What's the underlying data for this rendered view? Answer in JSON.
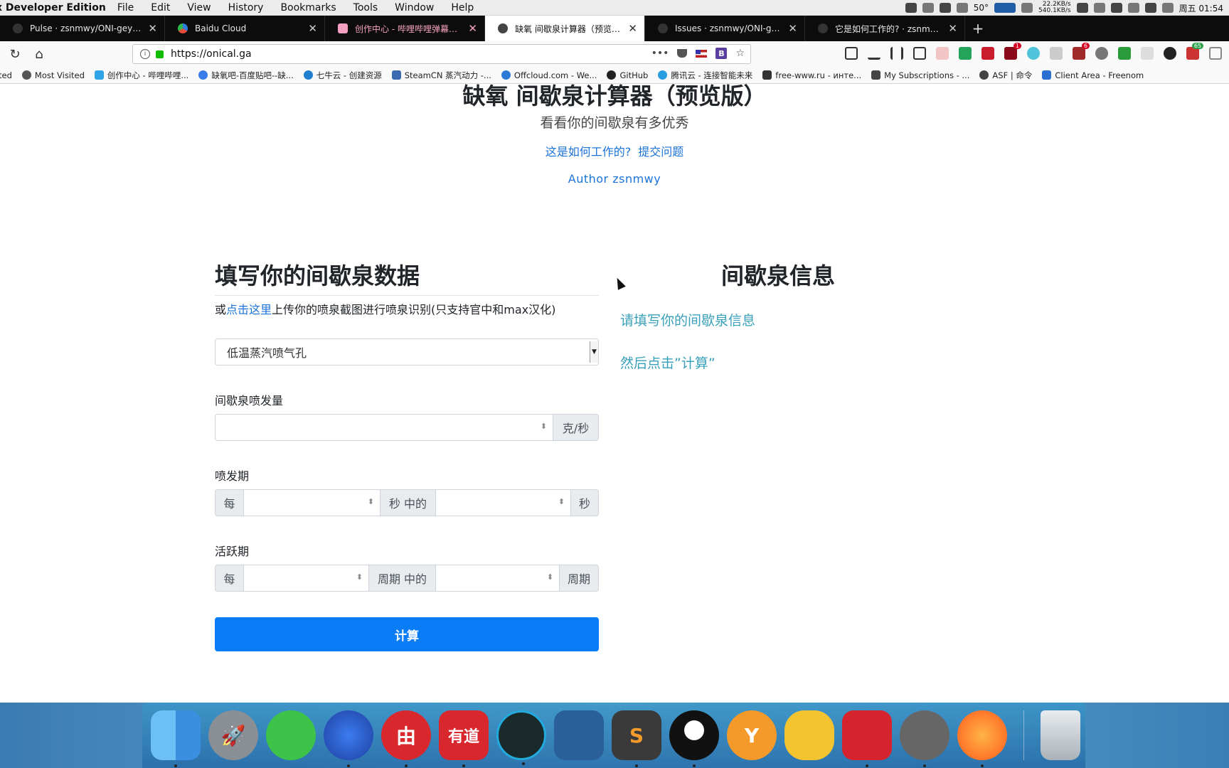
{
  "menubar": {
    "app": "x Developer Edition",
    "items": [
      "File",
      "Edit",
      "View",
      "History",
      "Bookmarks",
      "Tools",
      "Window",
      "Help"
    ],
    "temperature": "50°",
    "net_up": "22.2KB/s",
    "net_down": "540.1KB/s",
    "clock": "周五 01:54"
  },
  "tabs": [
    {
      "title": "Pulse · zsnmwy/ONI-geyser-cal",
      "favicon_color": "#333333"
    },
    {
      "title": "Baidu Cloud",
      "favicon_color": "#2f7de1"
    },
    {
      "title": "创作中心 - 哔哩哔哩弹幕视频网 -",
      "favicon_color": "#f5a0c0"
    },
    {
      "title": "缺氧 间歇泉计算器（预览版）",
      "favicon_color": "#444444"
    },
    {
      "title": "Issues · zsnmwy/ONI-geyser-ca",
      "favicon_color": "#333333"
    },
    {
      "title": "它是如何工作的? · zsnmwy/ONI",
      "favicon_color": "#333333"
    }
  ],
  "address": {
    "url": "https://onical.ga"
  },
  "bookmarks": [
    {
      "label": "ted",
      "color": "transparent"
    },
    {
      "label": "Most Visited",
      "color": "#555555"
    },
    {
      "label": "创作中心 - 哔哩哔哩...",
      "color": "#2fa4e7"
    },
    {
      "label": "缺氧吧-百度贴吧--缺...",
      "color": "#3b7de8"
    },
    {
      "label": "七牛云 - 创建资源",
      "color": "#1e7fcf"
    },
    {
      "label": "SteamCN 蒸汽动力 -...",
      "color": "#3a6bb0"
    },
    {
      "label": "Offcloud.com - We...",
      "color": "#2b7bd6"
    },
    {
      "label": "GitHub",
      "color": "#222222"
    },
    {
      "label": "腾讯云 - 连接智能未来",
      "color": "#2a9de0"
    },
    {
      "label": "free-www.ru - инте...",
      "color": "#333333"
    },
    {
      "label": "My Subscriptions - ...",
      "color": "#444444"
    },
    {
      "label": "ASF | 命令",
      "color": "#444444"
    },
    {
      "label": "Client Area - Freenom",
      "color": "#2a6fd1"
    }
  ],
  "page": {
    "title": "缺氧 间歇泉计算器（预览版）",
    "subtitle": "看看你的间歇泉有多优秀",
    "link_how": "这是如何工作的?",
    "link_issue": "提交问题",
    "author": "Author zsnmwy",
    "form": {
      "title": "填写你的间歇泉数据",
      "upload_prefix": "或",
      "upload_link": "点击这里",
      "upload_suffix": "上传你的喷泉截图进行喷泉识别(只支持官中和max汉化)",
      "geyser_type": "低温蒸汽喷气孔",
      "emission_label": "间歇泉喷发量",
      "emission_unit": "克/秒",
      "eruption_label": "喷发期",
      "eruption_every": "每",
      "eruption_mid": "秒 中的",
      "eruption_unit": "秒",
      "active_label": "活跃期",
      "active_every": "每",
      "active_mid": "周期 中的",
      "active_unit": "周期",
      "calc_button": "计算"
    },
    "info": {
      "title": "间歇泉信息",
      "line1": "请填写你的间歇泉信息",
      "line2": "然后点击”计算”"
    }
  },
  "dock": [
    {
      "name": "finder-icon",
      "color": "#4aa3e8",
      "glyph": ""
    },
    {
      "name": "launchpad-icon",
      "color": "#8a8f96",
      "glyph": "🚀"
    },
    {
      "name": "wechat-icon",
      "color": "#3dc34a",
      "glyph": ""
    },
    {
      "name": "firefox-developer-icon",
      "color": "#2b5fd4",
      "glyph": ""
    },
    {
      "name": "youdao-mail-icon",
      "color": "#d9272e",
      "glyph": "由"
    },
    {
      "name": "youdao-dict-icon",
      "color": "#d9272e",
      "glyph": "有道"
    },
    {
      "name": "gitkraken-icon",
      "color": "#1a2a2a",
      "glyph": ""
    },
    {
      "name": "vscode-icon",
      "color": "#2a5f9a",
      "glyph": ""
    },
    {
      "name": "sublime-icon",
      "color": "#3a3a3a",
      "glyph": "S"
    },
    {
      "name": "qq-icon",
      "color": "#1a1a1a",
      "glyph": ""
    },
    {
      "name": "yoink-icon",
      "color": "#f39a2a",
      "glyph": "Y"
    },
    {
      "name": "cyberduck-icon",
      "color": "#f4c430",
      "glyph": ""
    },
    {
      "name": "netease-music-icon",
      "color": "#d6242e",
      "glyph": ""
    },
    {
      "name": "screenflow-icon",
      "color": "#666666",
      "glyph": ""
    },
    {
      "name": "firefox-icon",
      "color": "#ff7b1c",
      "glyph": ""
    },
    {
      "name": "trash-icon",
      "color": "#c9ced3",
      "glyph": ""
    }
  ]
}
